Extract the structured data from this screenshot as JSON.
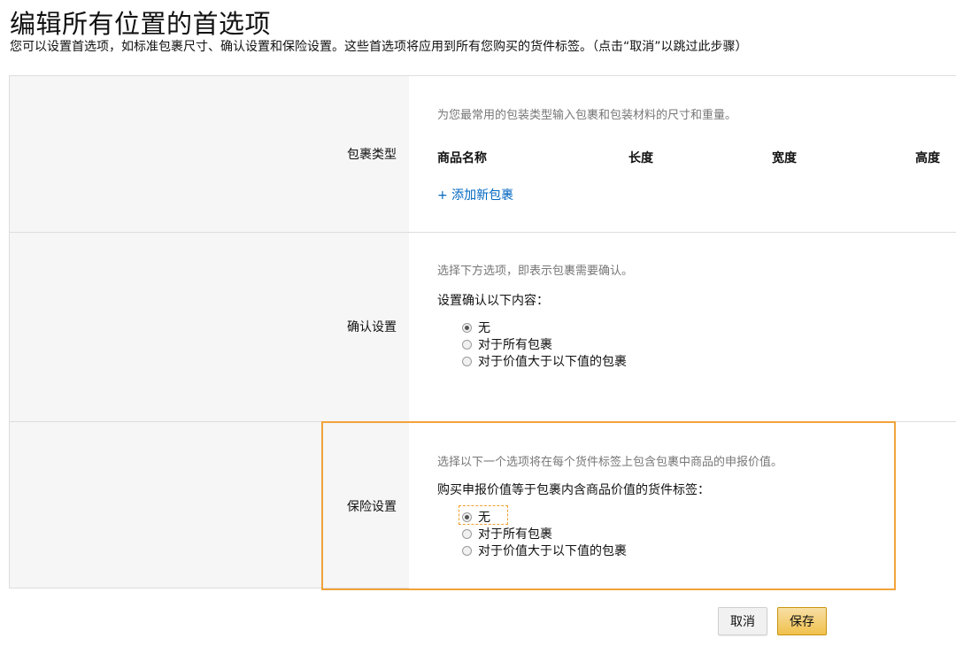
{
  "page": {
    "title": "编辑所有位置的首选项",
    "subtitle": "您可以设置首选项，如标准包裹尺寸、确认设置和保险设置。这些首选项将应用到所有您购买的货件标签。（点击“取消”以跳过此步骤）"
  },
  "sections": {
    "package_type": {
      "label": "包裹类型",
      "hint": "为您最常用的包装类型输入包裹和包装材料的尺寸和重量。",
      "columns": [
        "商品名称",
        "长度",
        "宽度",
        "高度"
      ],
      "add_link": "+ 添加新包裹"
    },
    "confirmation": {
      "label": "确认设置",
      "hint": "选择下方选项，即表示包裹需要确认。",
      "prompt": "设置确认以下内容：",
      "options": [
        "无",
        "对于所有包裹",
        "对于价值大于以下值的包裹"
      ],
      "selected_index": 0
    },
    "insurance": {
      "label": "保险设置",
      "hint": "选择以下一个选项将在每个货件标签上包含包裹中商品的申报价值。",
      "prompt": "购买申报价值等于包裹内含商品价值的货件标签：",
      "options": [
        "无",
        "对于所有包裹",
        "对于价值大于以下值的包裹"
      ],
      "selected_index": 0
    }
  },
  "buttons": {
    "cancel": "取消",
    "save": "保存"
  },
  "colors": {
    "link": "#0066c0",
    "highlight": "#f2a33a",
    "save_button": "#f0c14b",
    "panel_bg": "#f6f6f6"
  }
}
